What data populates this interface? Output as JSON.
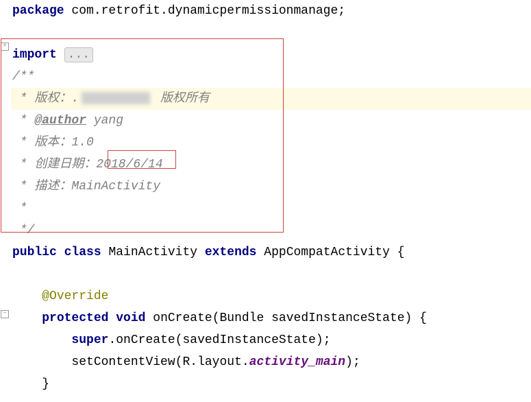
{
  "code": {
    "package_kw": "package",
    "package_name": " com.retrofit.dynamicpermissionmanage;",
    "import_kw": "import",
    "import_ellipsis": "...",
    "doc_open": "/**",
    "doc_copyright_prefix": " * 版权：.",
    "doc_copyright_suffix": " 版权所有",
    "doc_author_prefix": " * ",
    "doc_author_tag": "@author",
    "doc_author_name": " yang",
    "doc_version": " * 版本：1.0",
    "doc_date": " * 创建日期：2018/6/14",
    "doc_desc": " * 描述：MainActivity",
    "doc_empty": " *",
    "doc_close": " */",
    "public_kw": "public",
    "class_kw": "class",
    "class_name": " MainActivity ",
    "extends_kw": "extends",
    "super_class": " AppCompatActivity ",
    "brace_open": "{",
    "override": "@Override",
    "protected_kw": "protected",
    "void_kw": "void",
    "method_name": " onCreate",
    "paren_open": "(",
    "param": "Bundle savedInstanceState",
    "paren_close": ")",
    "method_brace_open": " {",
    "super_kw": "super",
    "super_call": ".onCreate",
    "super_arg": "savedInstanceState",
    "semi": ";",
    "setcontent": "setContentView",
    "r_layout": "R.layout.",
    "activity_main": "activity_main",
    "method_brace_close": "}"
  }
}
